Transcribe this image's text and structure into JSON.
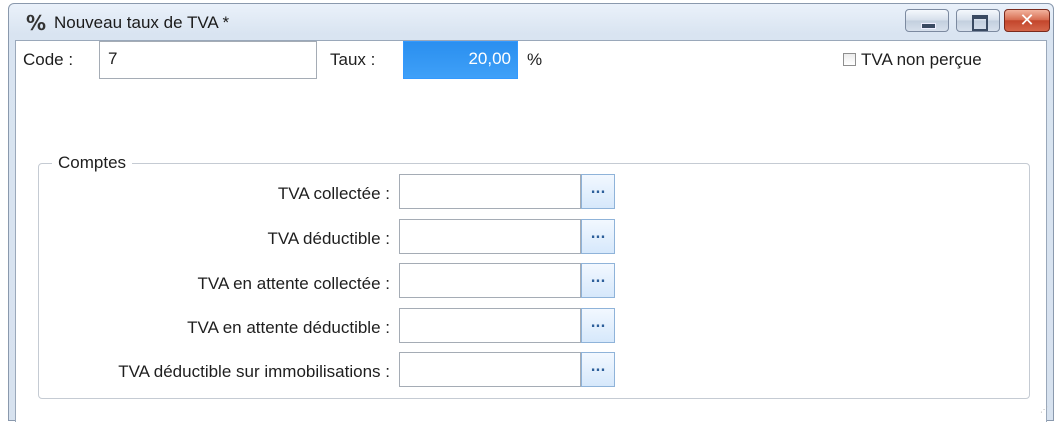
{
  "window": {
    "title": "Nouveau taux de TVA *",
    "icon": "percent-icon",
    "buttons": {
      "minimize": "minimize-icon",
      "maximize": "maximize-icon",
      "close": "close-icon"
    }
  },
  "form": {
    "code_label": "Code :",
    "code_value": "7",
    "taux_label": "Taux :",
    "taux_value": "20,00",
    "percent_symbol": "%",
    "tva_non_percue_label": "TVA non perçue",
    "tva_non_percue_checked": false
  },
  "comptes": {
    "title": "Comptes",
    "browse_glyph": "...",
    "fields": [
      {
        "label": "TVA collectée :",
        "value": ""
      },
      {
        "label": "TVA déductible :",
        "value": ""
      },
      {
        "label": "TVA en attente collectée :",
        "value": ""
      },
      {
        "label": "TVA en attente déductible :",
        "value": ""
      },
      {
        "label": "TVA déductible sur immobilisations :",
        "value": ""
      }
    ]
  },
  "colors": {
    "selection": "#3399ff",
    "browse_button_text": "#2d5f9a",
    "close_button": "#c8462c"
  }
}
